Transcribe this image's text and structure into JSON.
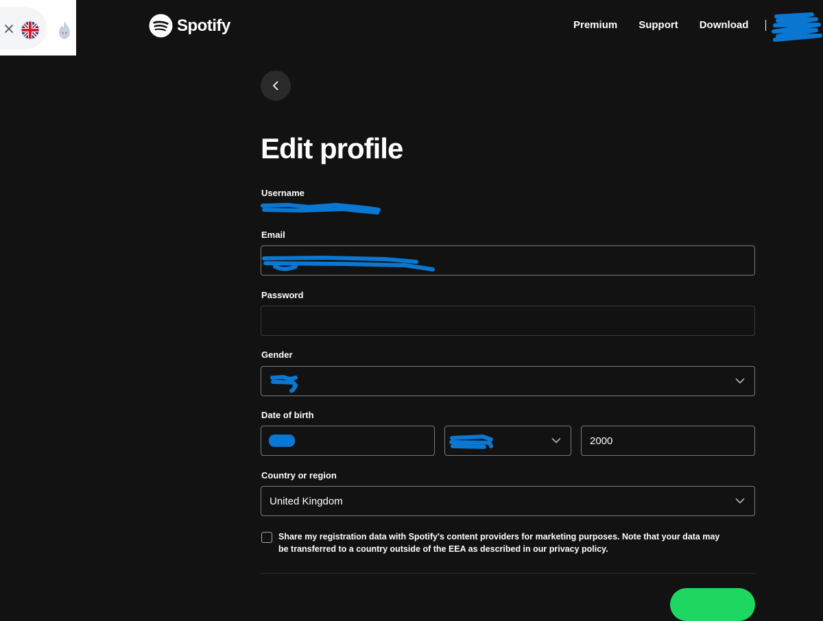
{
  "header": {
    "brand": "Spotify",
    "nav": [
      "Premium",
      "Support",
      "Download"
    ]
  },
  "page": {
    "title": "Edit profile"
  },
  "form": {
    "username": {
      "label": "Username",
      "value": ""
    },
    "email": {
      "label": "Email",
      "value": ""
    },
    "password": {
      "label": "Password",
      "value": ""
    },
    "gender": {
      "label": "Gender",
      "value": ""
    },
    "dob": {
      "label": "Date of birth",
      "day": "",
      "month": "",
      "year": "2000"
    },
    "country": {
      "label": "Country or region",
      "value": "United Kingdom"
    },
    "consent": {
      "text": "Share my registration data with Spotify's content providers for marketing purposes. Note that your data may be transferred to a country outside of the EEA as described in our privacy policy.",
      "checked": false
    }
  },
  "colors": {
    "background": "#121212",
    "accent": "#1ed760",
    "redaction": "#0a78d2"
  },
  "icons": {
    "back": "chevron-left-icon",
    "dropdown": "chevron-down-icon",
    "flag": "uk-flag-icon",
    "close": "close-icon",
    "extension": "flame-icon"
  }
}
